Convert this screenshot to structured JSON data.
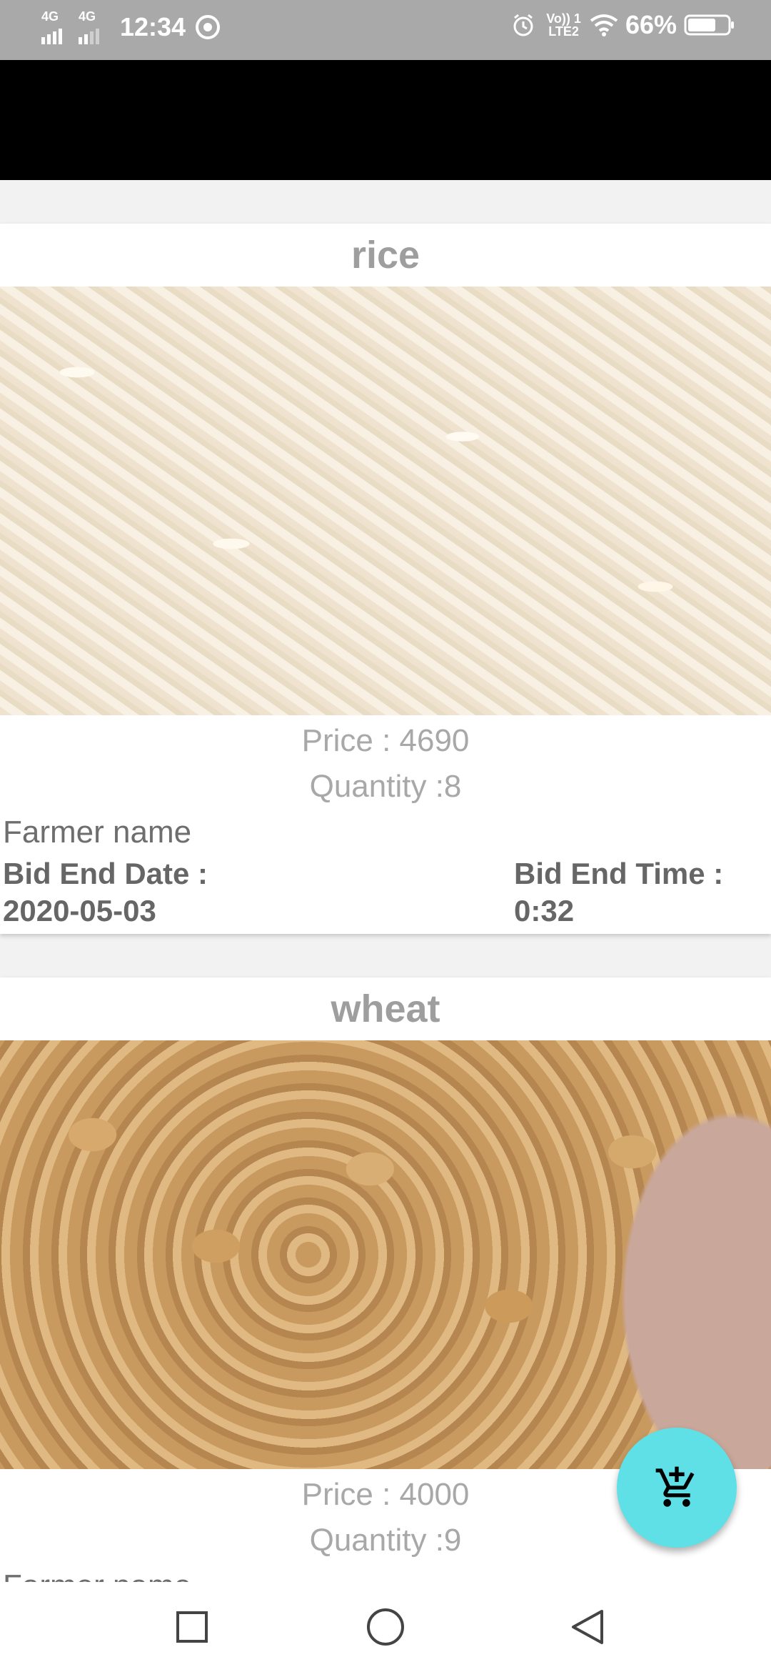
{
  "status_bar": {
    "network_1": "4G",
    "network_2": "4G",
    "time": "12:34",
    "volte_line1": "Vo)) 1",
    "volte_line2": "LTE2",
    "battery": "66%"
  },
  "products": [
    {
      "name": "rice",
      "price": "Price : 4690",
      "quantity": "Quantity :8",
      "farmer": "Farmer name",
      "bid_end_date_label": "Bid End Date :",
      "bid_end_date": "2020-05-03",
      "bid_end_time_label": "Bid End Time :",
      "bid_end_time": "0:32"
    },
    {
      "name": "wheat",
      "price": "Price : 4000",
      "quantity": "Quantity :9",
      "farmer": "Farmer name"
    }
  ],
  "fab": {
    "icon": "add-shopping-cart-icon",
    "color": "#5fe0e6"
  },
  "nav": {
    "recents_icon": "square-icon",
    "home_icon": "circle-icon",
    "back_icon": "triangle-back-icon"
  }
}
